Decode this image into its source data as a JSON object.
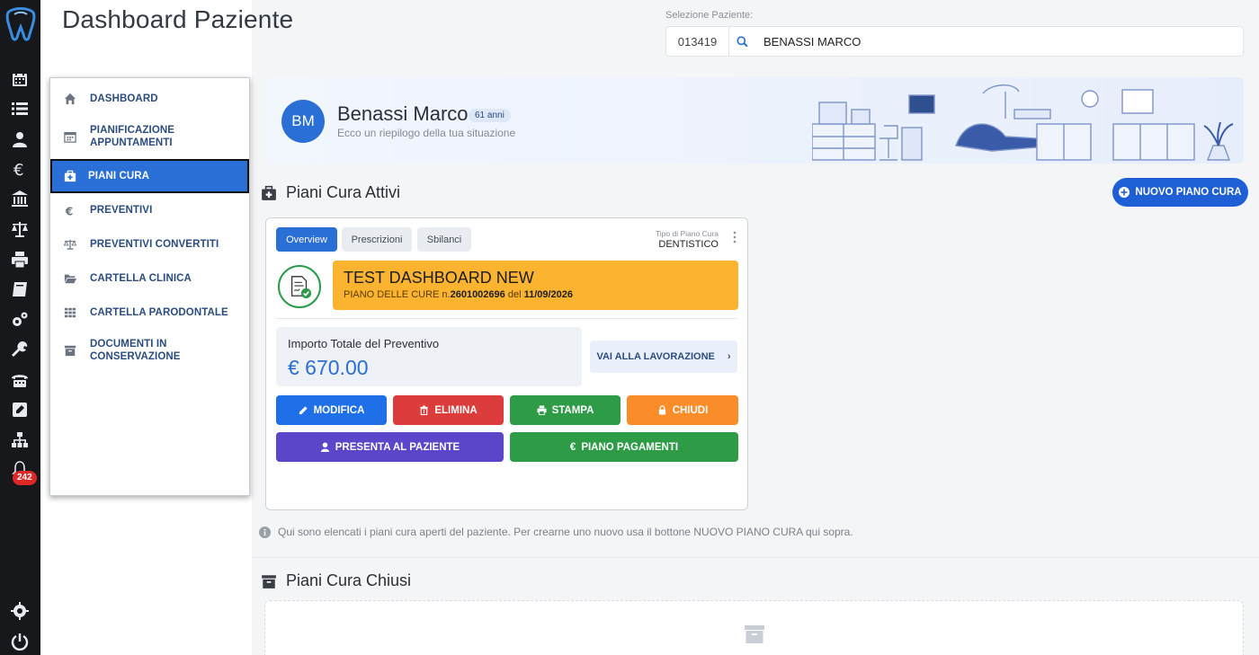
{
  "page": {
    "title": "Dashboard Paziente"
  },
  "patient_select": {
    "label": "Selezione Paziente:",
    "code": "013419",
    "name": "BENASSI MARCO"
  },
  "rail": {
    "notifications_count": "242",
    "icons": [
      "calendar-icon",
      "list-icon",
      "users-icon",
      "euro-icon",
      "bank-icon",
      "scale-icon",
      "printer-icon",
      "book-icon",
      "cogs-icon",
      "wrench-icon",
      "fax-icon",
      "edit-icon",
      "sitemap-icon",
      "bell-icon",
      "settings-icon",
      "power-icon"
    ]
  },
  "sidebar": {
    "items": [
      {
        "label": "DASHBOARD",
        "icon": "home-icon"
      },
      {
        "label": "PIANIFICAZIONE APPUNTAMENTI",
        "icon": "calendar-icon"
      },
      {
        "label": "PIANI CURA",
        "icon": "medkit-icon",
        "active": true
      },
      {
        "label": "PREVENTIVI",
        "icon": "euro-icon"
      },
      {
        "label": "PREVENTIVI CONVERTITI",
        "icon": "scale-icon"
      },
      {
        "label": "CARTELLA CLINICA",
        "icon": "folder-open-icon"
      },
      {
        "label": "CARTELLA PARODONTALE",
        "icon": "grid-icon"
      },
      {
        "label": "DOCUMENTI IN CONSERVAZIONE",
        "icon": "archive-icon"
      }
    ]
  },
  "patient": {
    "initials": "BM",
    "name": "Benassi Marco",
    "age": "61 anni",
    "subtitle": "Ecco un riepilogo della tua situazione"
  },
  "active_plans": {
    "title": "Piani Cura Attivi",
    "new_button": "NUOVO PIANO CURA",
    "tabs": [
      "Overview",
      "Prescrizioni",
      "Sbilanci"
    ],
    "tipo_label": "Tipo di Piano Cura",
    "tipo_value": "DENTISTICO",
    "plan_title": "TEST DASHBOARD NEW",
    "plan_prefix": "PIANO DELLE CURE n.",
    "plan_number": "2601002696",
    "plan_mid": " del ",
    "plan_date": "11/09/2026",
    "total_label": "Importo Totale del Preventivo",
    "total_value": "€ 670.00",
    "work_button": "VAI ALLA LAVORAZIONE",
    "buttons": {
      "modifica": "MODIFICA",
      "elimina": "ELIMINA",
      "stampa": "STAMPA",
      "chiudi": "CHIUDI",
      "presenta": "PRESENTA AL PAZIENTE",
      "pagamenti": "PIANO PAGAMENTI"
    },
    "info": "Qui sono elencati i piani cura aperti del paziente. Per crearne uno nuovo usa il bottone NUOVO PIANO CURA qui sopra."
  },
  "closed_plans": {
    "title": "Piani Cura Chiusi"
  },
  "colors": {
    "primary": "#2a6fd6",
    "danger": "#dc3c3c",
    "success": "#2e9c46",
    "warning": "#fb8c2a",
    "purple": "#5b45c9",
    "plan_banner": "#fbb330"
  }
}
